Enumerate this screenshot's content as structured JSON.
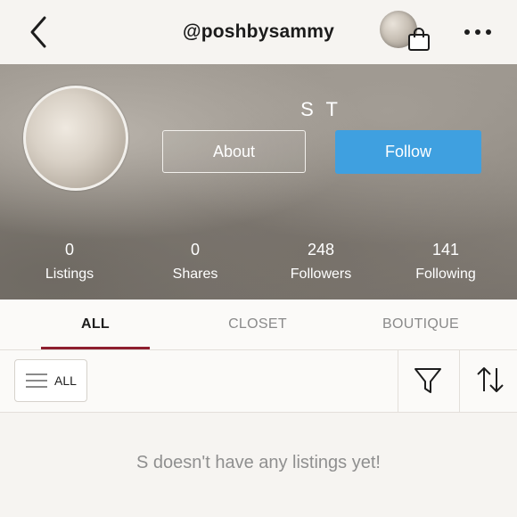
{
  "header": {
    "username": "@poshbysammy"
  },
  "icons": {
    "back": "chevron-left-icon",
    "bag": "shopping-bag-icon",
    "more": "more-dots-icon",
    "menu": "hamburger-icon",
    "filter": "filter-funnel-icon",
    "sort": "sort-arrows-icon"
  },
  "profile": {
    "display_name": "S T",
    "about_label": "About",
    "follow_label": "Follow"
  },
  "stats": [
    {
      "value": "0",
      "label": "Listings"
    },
    {
      "value": "0",
      "label": "Shares"
    },
    {
      "value": "248",
      "label": "Followers"
    },
    {
      "value": "141",
      "label": "Following"
    }
  ],
  "tabs": [
    {
      "label": "ALL",
      "active": true
    },
    {
      "label": "CLOSET",
      "active": false
    },
    {
      "label": "BOUTIQUE",
      "active": false
    }
  ],
  "filter": {
    "all_label": "ALL"
  },
  "empty_message": "S doesn't have any listings yet!",
  "colors": {
    "follow_blue": "#3fa0e0",
    "tab_underline": "#8e1f2f",
    "background": "#f6f4f1"
  }
}
